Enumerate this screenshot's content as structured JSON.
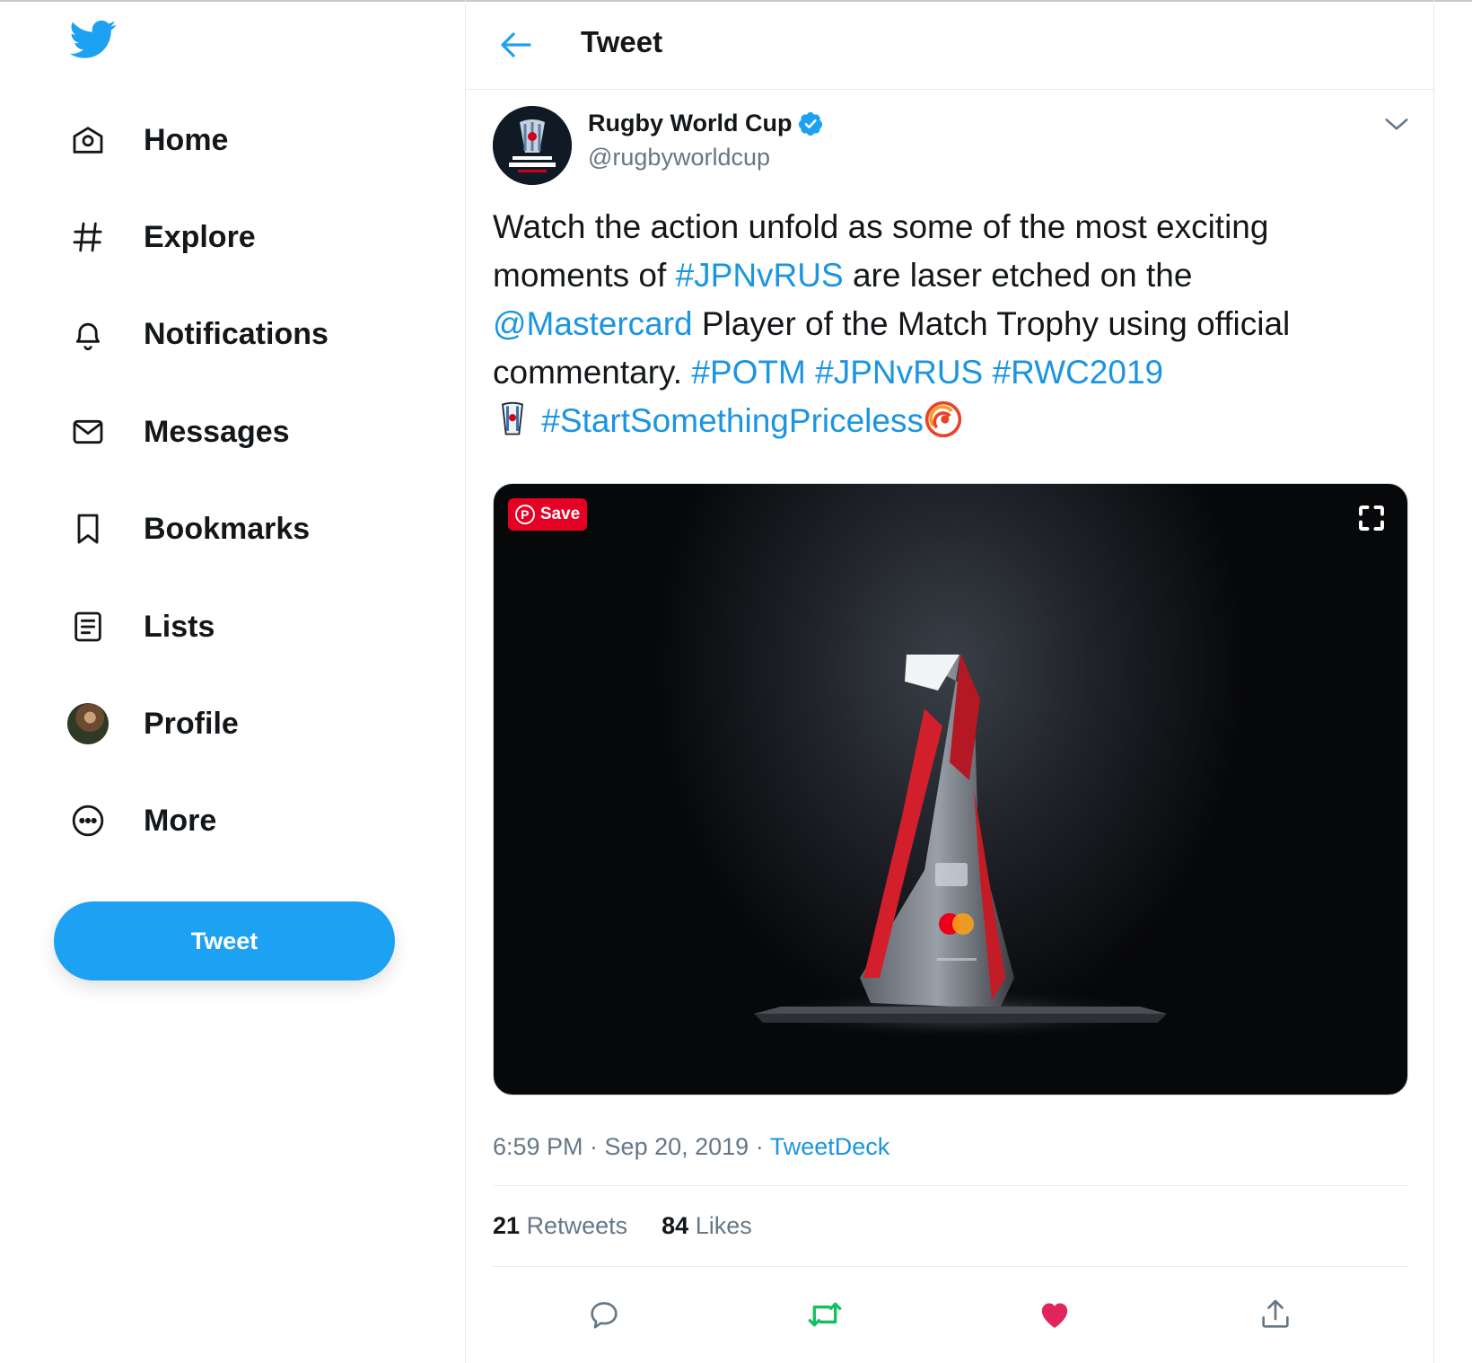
{
  "colors": {
    "brand": "#1da1f2",
    "link": "#1b95e0",
    "retweet": "#17bf63",
    "like": "#e0245e",
    "pinterest": "#e60023"
  },
  "sidebar": {
    "logo_icon": "twitter-bird-icon",
    "items": [
      {
        "label": "Home",
        "icon": "home-icon"
      },
      {
        "label": "Explore",
        "icon": "hashtag-icon"
      },
      {
        "label": "Notifications",
        "icon": "bell-icon"
      },
      {
        "label": "Messages",
        "icon": "envelope-icon"
      },
      {
        "label": "Bookmarks",
        "icon": "bookmark-icon"
      },
      {
        "label": "Lists",
        "icon": "list-icon"
      },
      {
        "label": "Profile",
        "icon": "avatar"
      },
      {
        "label": "More",
        "icon": "more-circle-icon"
      }
    ],
    "tweet_button": "Tweet"
  },
  "header": {
    "title": "Tweet",
    "back_icon": "back-arrow-icon"
  },
  "tweet": {
    "author_name": "Rugby World Cup",
    "author_handle": "@rugbyworldcup",
    "text": {
      "p1": "Watch the action unfold as some of the most exciting moments of ",
      "h1": "#JPNvRUS",
      "p2": " are laser etched on the ",
      "m1": "@Mastercard",
      "p3": " Player of the Match Trophy using official commentary. ",
      "h2": "#POTM",
      "h3": "#JPNvRUS",
      "h4": "#RWC2019",
      "h5": "#StartSomethingPriceless"
    },
    "media": {
      "save_label": "Save"
    },
    "time": "6:59 PM · Sep 20, 2019 · ",
    "source": "TweetDeck",
    "retweets_count": "21",
    "retweets_label": "Retweets",
    "likes_count": "84",
    "likes_label": "Likes"
  }
}
